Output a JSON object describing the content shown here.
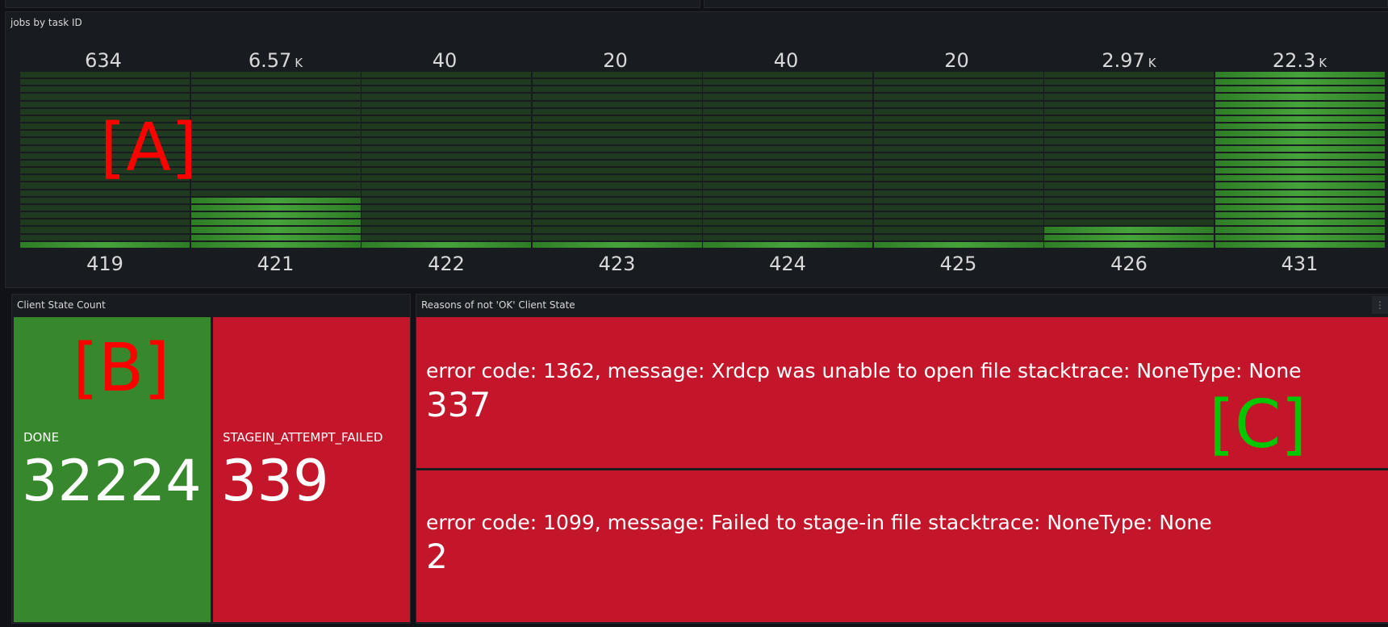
{
  "jobs_panel": {
    "title": "jobs by task ID",
    "columns": [
      {
        "label": "419",
        "value": "634",
        "suffix": "",
        "fill_fraction": 0.028
      },
      {
        "label": "421",
        "value": "6.57",
        "suffix": "K",
        "fill_fraction": 0.294
      },
      {
        "label": "422",
        "value": "40",
        "suffix": "",
        "fill_fraction": 0.002
      },
      {
        "label": "423",
        "value": "20",
        "suffix": "",
        "fill_fraction": 0.001
      },
      {
        "label": "424",
        "value": "40",
        "suffix": "",
        "fill_fraction": 0.002
      },
      {
        "label": "425",
        "value": "20",
        "suffix": "",
        "fill_fraction": 0.001
      },
      {
        "label": "426",
        "value": "2.97",
        "suffix": "K",
        "fill_fraction": 0.133
      },
      {
        "label": "431",
        "value": "22.3",
        "suffix": "K",
        "fill_fraction": 1.0
      }
    ]
  },
  "client_state_panel": {
    "title": "Client State Count",
    "stats": [
      {
        "name": "DONE",
        "value": "32224",
        "color": "#37872d"
      },
      {
        "name": "STAGEIN_ATTEMPT_FAILED",
        "value": "339",
        "color": "#c4162a"
      }
    ]
  },
  "reasons_panel": {
    "title": "Reasons of not 'OK' Client State",
    "menu_icon": "⋮",
    "reasons": [
      {
        "text": "error code: 1362, message: Xrdcp was unable to open file stacktrace: NoneType: None",
        "value": "337"
      },
      {
        "text": "error code: 1099, message: Failed to stage-in file stacktrace: NoneType: None",
        "value": "2"
      }
    ]
  },
  "annotations": {
    "a": "[A]",
    "b": "[B]",
    "c": "[C]"
  }
}
